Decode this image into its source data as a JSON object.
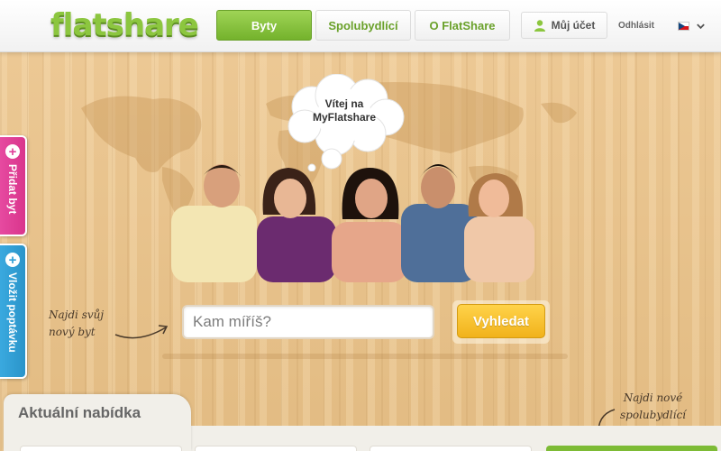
{
  "header": {
    "logo": "flatshare",
    "nav": [
      {
        "label": "Byty",
        "active": true
      },
      {
        "label": "Spolubydlící",
        "active": false
      },
      {
        "label": "O FlatShare",
        "active": false
      }
    ],
    "account_label": "Můj účet",
    "logout_label": "Odhlásit",
    "language_icon": "czech-flag-icon"
  },
  "hero": {
    "bubble_line1": "Vítej na",
    "bubble_line2": "MyFlatshare"
  },
  "side_tabs": {
    "add_flat": "Přidat byt",
    "add_request": "Vložit poptávku"
  },
  "search": {
    "hint_line1": "Najdi svůj",
    "hint_line2": "nový byt",
    "placeholder": "Kam míříš?",
    "button_label": "Vyhledat"
  },
  "bottom": {
    "section_title": "Aktuální nabídka",
    "roommates_hint_line1": "Najdi nové",
    "roommates_hint_line2": "spolubydlící"
  },
  "colors": {
    "brand_green": "#8cc63f",
    "accent_yellow": "#f1b21b",
    "tab_pink": "#e0409a",
    "tab_blue": "#2f9fd6",
    "wood": "#e9c590"
  }
}
